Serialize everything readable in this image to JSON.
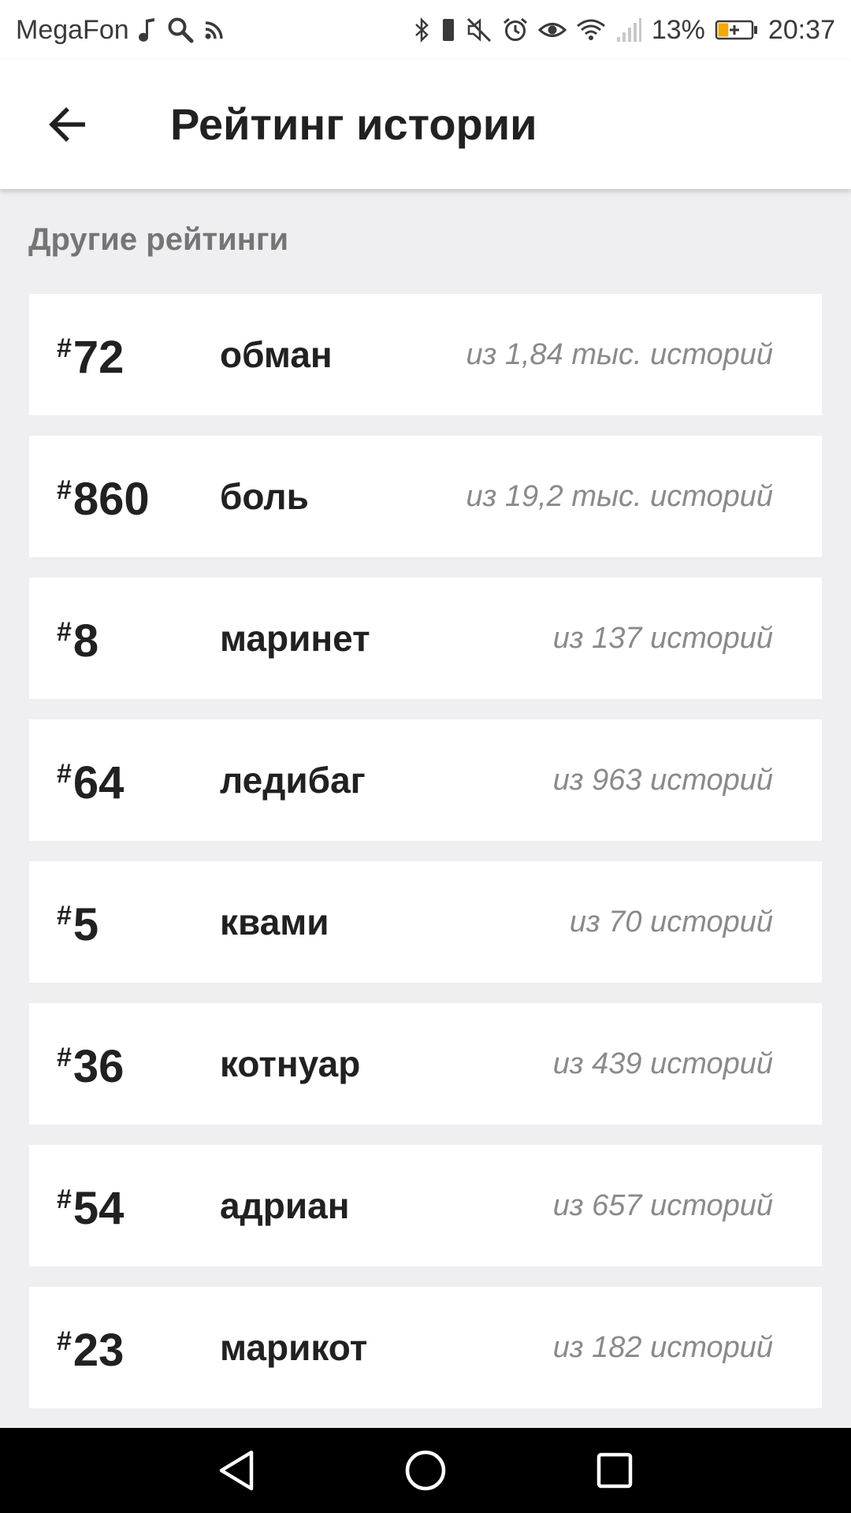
{
  "status_bar": {
    "carrier": "MegaFon",
    "battery_percent": "13%",
    "time": "20:37",
    "left_icons": [
      "music-note-icon",
      "search-icon",
      "rss-icon"
    ],
    "right_icons": [
      "bluetooth-icon",
      "vibrate-icon",
      "mute-icon",
      "alarm-icon",
      "eye-icon",
      "wifi-icon",
      "signal-icon",
      "battery-charging-icon"
    ],
    "battery_level": 0.13,
    "battery_color": "#f5a800"
  },
  "app_bar": {
    "title": "Рейтинг истории",
    "back_icon": "arrow-left-icon"
  },
  "section": {
    "title": "Другие рейтинги"
  },
  "ratings": [
    {
      "hash": "#",
      "rank": "72",
      "tag": "обман",
      "count": "из 1,84 тыс. историй"
    },
    {
      "hash": "#",
      "rank": "860",
      "tag": "боль",
      "count": "из 19,2 тыс. историй"
    },
    {
      "hash": "#",
      "rank": "8",
      "tag": "маринет",
      "count": "из 137 историй"
    },
    {
      "hash": "#",
      "rank": "64",
      "tag": "ледибаг",
      "count": "из 963 историй"
    },
    {
      "hash": "#",
      "rank": "5",
      "tag": "квами",
      "count": "из 70 историй"
    },
    {
      "hash": "#",
      "rank": "36",
      "tag": "котнуар",
      "count": "из 439 историй"
    },
    {
      "hash": "#",
      "rank": "54",
      "tag": "адриан",
      "count": "из 657 историй"
    },
    {
      "hash": "#",
      "rank": "23",
      "tag": "марикот",
      "count": "из 182 историй"
    }
  ],
  "nav_bar": {
    "buttons": [
      "back-triangle-icon",
      "home-circle-icon",
      "recents-square-icon"
    ]
  },
  "colors": {
    "background": "#efeef1",
    "card": "#ffffff",
    "primary_text": "#212121",
    "secondary_text": "#8a8a8a",
    "section_text": "#757575"
  }
}
